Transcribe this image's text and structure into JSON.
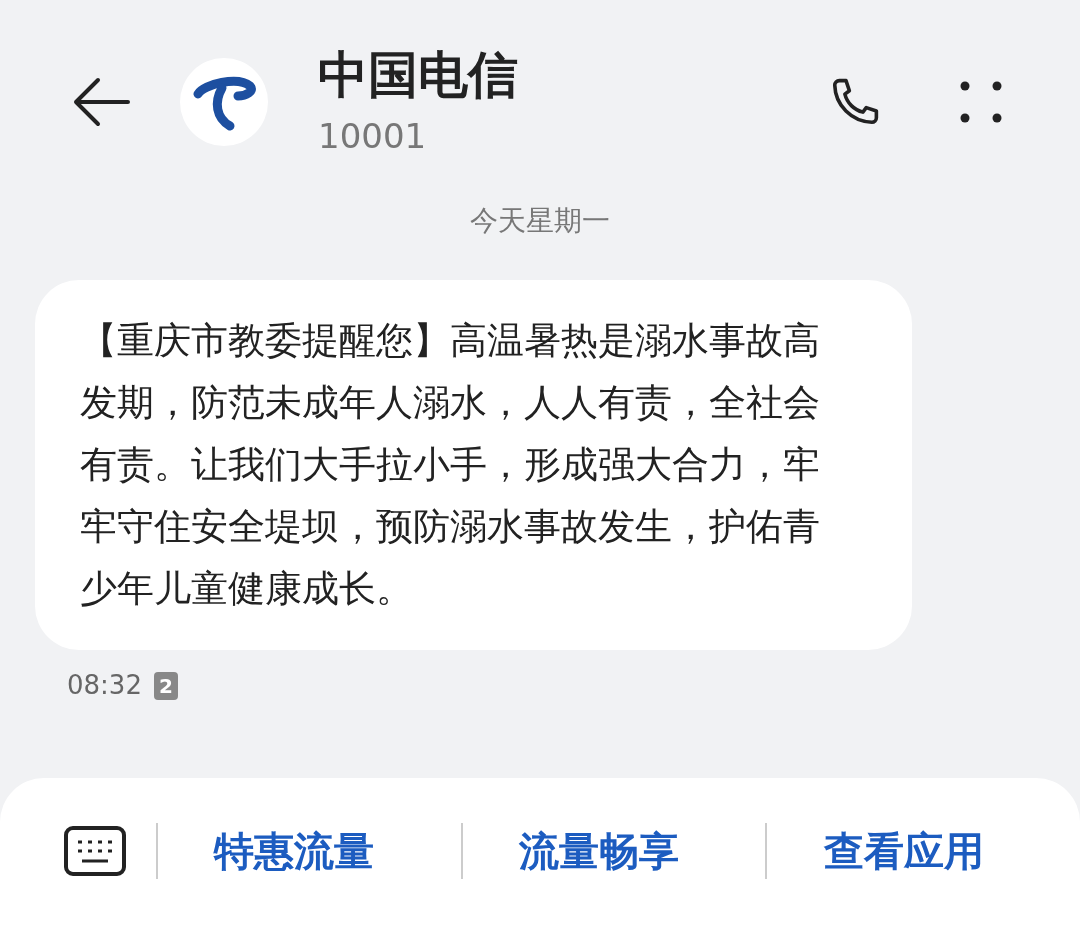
{
  "header": {
    "title": "中国电信",
    "number": "10001"
  },
  "date_divider": "今天星期一",
  "messages": [
    {
      "text": "【重庆市教委提醒您】高温暑热是溺水事故高发期，防范未成年人溺水，人人有责，全社会有责。让我们大手拉小手，形成强大合力，牢牢守住安全堤坝，预防溺水事故发生，护佑青少年儿童健康成长。",
      "time": "08:32",
      "sim": "2"
    }
  ],
  "quick_replies": [
    "特惠流量",
    "流量畅享",
    "查看应用"
  ]
}
